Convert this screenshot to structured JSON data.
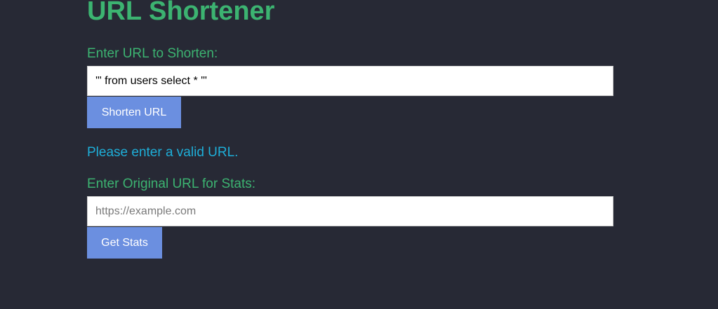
{
  "header": {
    "title": "URL Shortener"
  },
  "shorten_form": {
    "label": "Enter URL to Shorten:",
    "input_value": "'\" from users select * '\"",
    "button_label": "Shorten URL"
  },
  "message": {
    "text": "Please enter a valid URL."
  },
  "stats_form": {
    "label": "Enter Original URL for Stats:",
    "input_value": "",
    "placeholder": "https://example.com",
    "button_label": "Get Stats"
  },
  "colors": {
    "background": "#272935",
    "title": "#3cb371",
    "label": "#3cb371",
    "message": "#1eaed8",
    "button": "#6b8fe0"
  }
}
